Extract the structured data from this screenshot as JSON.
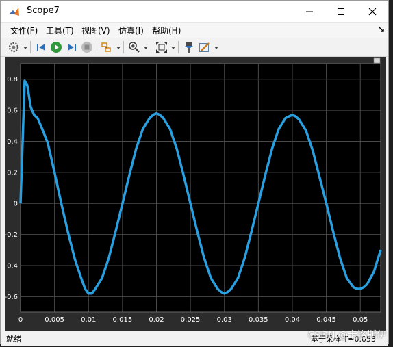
{
  "window": {
    "title": "Scope7"
  },
  "menu": {
    "items": [
      "文件(F)",
      "工具(T)",
      "视图(V)",
      "仿真(I)",
      "帮助(H)"
    ]
  },
  "toolbar": {
    "icons": [
      "settings-icon",
      "step-back-icon",
      "run-icon",
      "step-forward-icon",
      "stop-icon",
      "highlight-icon",
      "zoom-in-icon",
      "fit-to-view-icon",
      "pin-icon",
      "edit-style-icon"
    ]
  },
  "status": {
    "left_text": "就绪",
    "right_text": "基于采样",
    "right_value": "T=0.053"
  },
  "watermark": {
    "text": "CSDN @卡洛斯伊"
  },
  "colors": {
    "plot_background": "#000000",
    "plot_frame": "#2c2c2c",
    "grid": "#4a4a4a",
    "trace": "#2a9fe0",
    "axis_text": "#ffffff"
  },
  "chart_data": {
    "type": "line",
    "title": "",
    "xlabel": "",
    "ylabel": "",
    "xlim": [
      0,
      0.053
    ],
    "ylim": [
      -0.7,
      0.9
    ],
    "x_ticks": [
      "0",
      "0.005",
      "0.01",
      "0.015",
      "0.02",
      "0.025",
      "0.03",
      "0.035",
      "0.04",
      "0.045",
      "0.05"
    ],
    "y_ticks": [
      "0.8",
      "0.6",
      "0.4",
      "0.2",
      "0",
      "-0.2",
      "-0.4",
      "-0.6"
    ],
    "grid": true,
    "series": [
      {
        "x": [
          0,
          0.0006,
          0.001,
          0.0015,
          0.002,
          0.0025,
          0.003,
          0.004,
          0.005,
          0.006,
          0.007,
          0.008,
          0.009,
          0.0095,
          0.01,
          0.0105,
          0.011,
          0.012,
          0.013,
          0.014,
          0.015,
          0.016,
          0.017,
          0.018,
          0.019,
          0.0195,
          0.02,
          0.0205,
          0.021,
          0.022,
          0.023,
          0.024,
          0.025,
          0.026,
          0.027,
          0.028,
          0.029,
          0.0295,
          0.03,
          0.0305,
          0.031,
          0.032,
          0.033,
          0.034,
          0.035,
          0.036,
          0.037,
          0.038,
          0.039,
          0.0395,
          0.04,
          0.0405,
          0.041,
          0.042,
          0.043,
          0.044,
          0.045,
          0.046,
          0.047,
          0.048,
          0.049,
          0.0495,
          0.05,
          0.0505,
          0.051,
          0.052,
          0.053
        ],
        "y": [
          0.0,
          0.79,
          0.76,
          0.62,
          0.57,
          0.55,
          0.5,
          0.39,
          0.2,
          0.0,
          -0.19,
          -0.36,
          -0.49,
          -0.55,
          -0.58,
          -0.58,
          -0.55,
          -0.48,
          -0.35,
          -0.18,
          0.0,
          0.18,
          0.35,
          0.48,
          0.55,
          0.57,
          0.58,
          0.57,
          0.55,
          0.48,
          0.35,
          0.18,
          0.0,
          -0.18,
          -0.35,
          -0.48,
          -0.55,
          -0.57,
          -0.58,
          -0.57,
          -0.55,
          -0.48,
          -0.35,
          -0.18,
          0.0,
          0.18,
          0.35,
          0.48,
          0.55,
          0.56,
          0.57,
          0.56,
          0.54,
          0.47,
          0.34,
          0.17,
          0.0,
          -0.18,
          -0.35,
          -0.48,
          -0.54,
          -0.55,
          -0.55,
          -0.54,
          -0.52,
          -0.44,
          -0.3
        ]
      }
    ]
  }
}
